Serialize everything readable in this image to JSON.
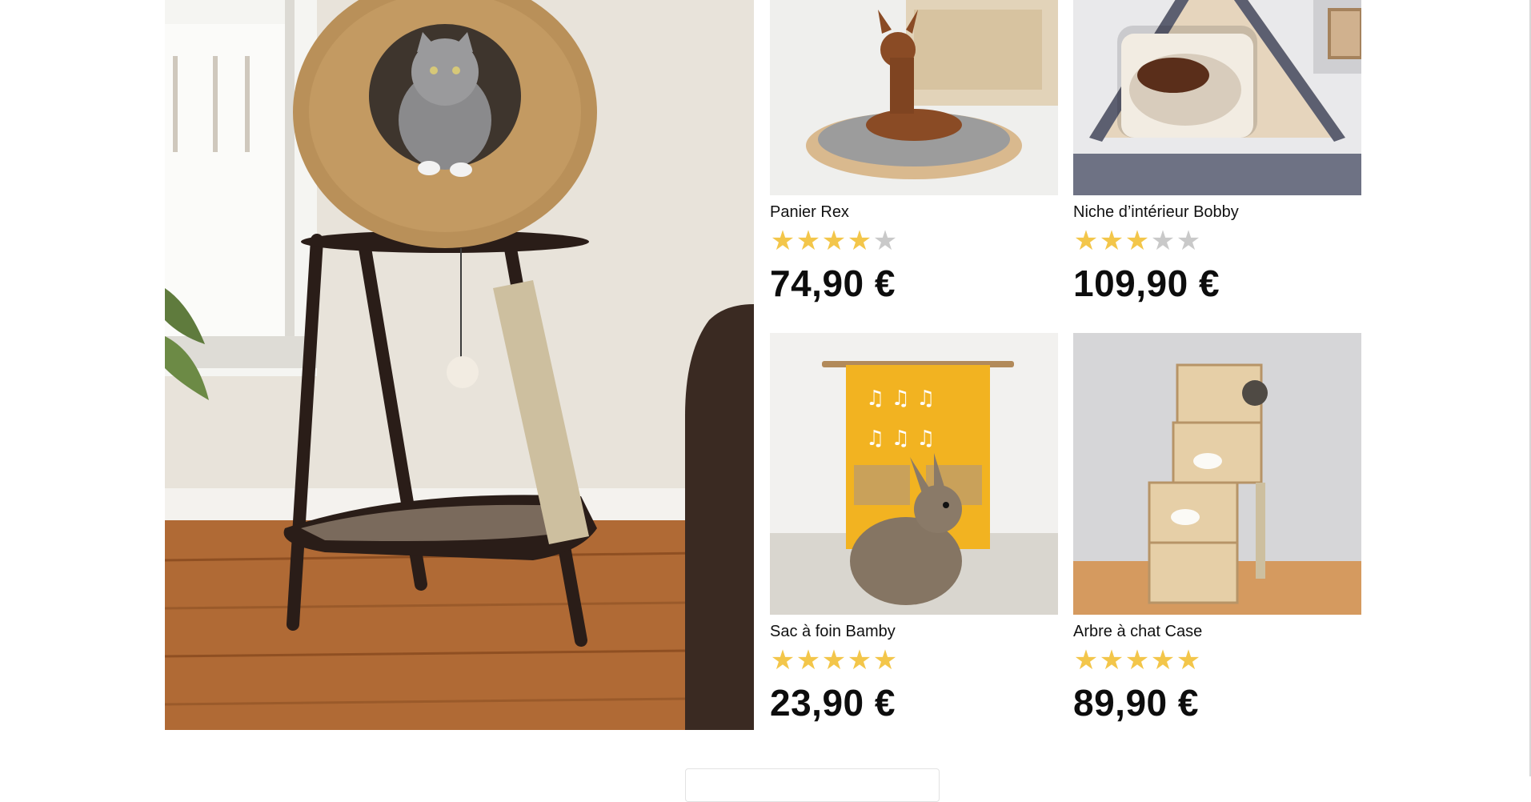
{
  "products": [
    {
      "name": "Panier Rex",
      "rating": 4,
      "max_rating": 5,
      "price": "74,90 €"
    },
    {
      "name": "Niche d’intérieur Bobby",
      "rating": 3,
      "max_rating": 5,
      "price": "109,90 €"
    },
    {
      "name": "Sac à foin Bamby",
      "rating": 5,
      "max_rating": 5,
      "price": "23,90 €"
    },
    {
      "name": "Arbre à chat Case",
      "rating": 5,
      "max_rating": 5,
      "price": "89,90 €"
    }
  ],
  "colors": {
    "star_filled": "#f3c64a",
    "star_empty": "#c9c9c9",
    "price_text": "#0d0d0d"
  },
  "icons": {
    "star_filled": "star-filled-icon",
    "star_empty": "star-empty-icon"
  }
}
